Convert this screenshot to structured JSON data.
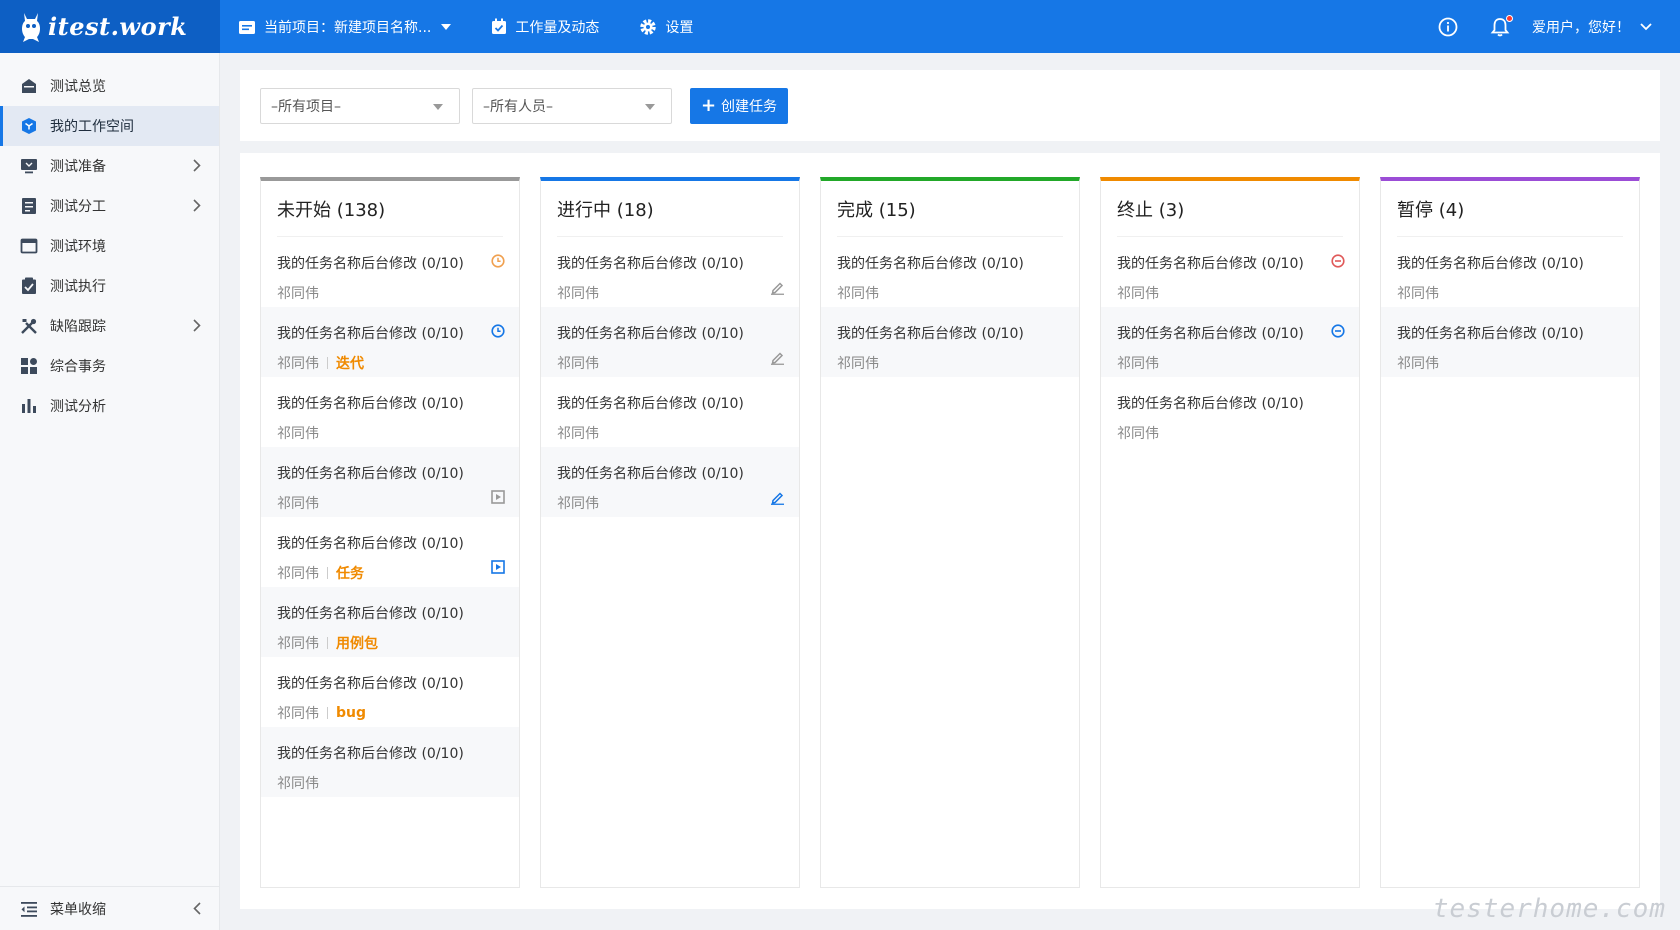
{
  "app": {
    "logo_text": "itest.work"
  },
  "topnav": {
    "project_label": "当前项目：新建项目名称...",
    "workload_label": "工作量及动态",
    "settings_label": "设置"
  },
  "user": {
    "greeting": "爱用户，您好！"
  },
  "sidebar": {
    "items": [
      {
        "label": "测试总览"
      },
      {
        "label": "我的工作空间"
      },
      {
        "label": "测试准备"
      },
      {
        "label": "测试分工"
      },
      {
        "label": "测试环境"
      },
      {
        "label": "测试执行"
      },
      {
        "label": "缺陷跟踪"
      },
      {
        "label": "综合事务"
      },
      {
        "label": "测试分析"
      }
    ],
    "collapse_label": "菜单收缩"
  },
  "filters": {
    "project": "–所有项目–",
    "people": "–所有人员–",
    "create_label": "创建任务"
  },
  "colors": {
    "primary": "#1677e6",
    "not_started": "#999999",
    "in_progress": "#1677e6",
    "done": "#22a829",
    "terminated": "#f08a00",
    "paused": "#9b4dd6",
    "tag": "#f08a00"
  },
  "columns": [
    {
      "title": "未开始 (138)",
      "cards": [
        {
          "title": "我的任务名称后台修改 (0/10)",
          "owner": "祁同伟",
          "tag": "",
          "icon": "clock-icon"
        },
        {
          "title": "我的任务名称后台修改 (0/10)",
          "owner": "祁同伟",
          "tag": "迭代",
          "icon": "clock-icon"
        },
        {
          "title": "我的任务名称后台修改 (0/10)",
          "owner": "祁同伟",
          "tag": "",
          "icon": ""
        },
        {
          "title": "我的任务名称后台修改 (0/10)",
          "owner": "祁同伟",
          "tag": "",
          "icon": "play-box-icon"
        },
        {
          "title": "我的任务名称后台修改 (0/10)",
          "owner": "祁同伟",
          "tag": "任务",
          "icon": "play-box-icon"
        },
        {
          "title": "我的任务名称后台修改 (0/10)",
          "owner": "祁同伟",
          "tag": "用例包",
          "icon": ""
        },
        {
          "title": "我的任务名称后台修改 (0/10)",
          "owner": "祁同伟",
          "tag": "bug",
          "icon": ""
        },
        {
          "title": "我的任务名称后台修改 (0/10)",
          "owner": "祁同伟",
          "tag": "",
          "icon": ""
        }
      ]
    },
    {
      "title": "进行中 (18)",
      "cards": [
        {
          "title": "我的任务名称后台修改 (0/10)",
          "owner": "祁同伟",
          "tag": "",
          "icon": "edit-icon"
        },
        {
          "title": "我的任务名称后台修改 (0/10)",
          "owner": "祁同伟",
          "tag": "",
          "icon": "edit-icon"
        },
        {
          "title": "我的任务名称后台修改 (0/10)",
          "owner": "祁同伟",
          "tag": "",
          "icon": ""
        },
        {
          "title": "我的任务名称后台修改 (0/10)",
          "owner": "祁同伟",
          "tag": "",
          "icon": "edit-icon"
        }
      ]
    },
    {
      "title": "完成 (15)",
      "cards": [
        {
          "title": "我的任务名称后台修改 (0/10)",
          "owner": "祁同伟",
          "tag": "",
          "icon": ""
        },
        {
          "title": "我的任务名称后台修改 (0/10)",
          "owner": "祁同伟",
          "tag": "",
          "icon": ""
        }
      ]
    },
    {
      "title": "终止 (3)",
      "cards": [
        {
          "title": "我的任务名称后台修改 (0/10)",
          "owner": "祁同伟",
          "tag": "",
          "icon": "minus-circle-icon"
        },
        {
          "title": "我的任务名称后台修改 (0/10)",
          "owner": "祁同伟",
          "tag": "",
          "icon": "minus-circle-icon"
        },
        {
          "title": "我的任务名称后台修改 (0/10)",
          "owner": "祁同伟",
          "tag": "",
          "icon": ""
        }
      ]
    },
    {
      "title": "暂停 (4)",
      "cards": [
        {
          "title": "我的任务名称后台修改 (0/10)",
          "owner": "祁同伟",
          "tag": "",
          "icon": ""
        },
        {
          "title": "我的任务名称后台修改 (0/10)",
          "owner": "祁同伟",
          "tag": "",
          "icon": ""
        }
      ]
    }
  ],
  "watermark": "testerhome.com"
}
